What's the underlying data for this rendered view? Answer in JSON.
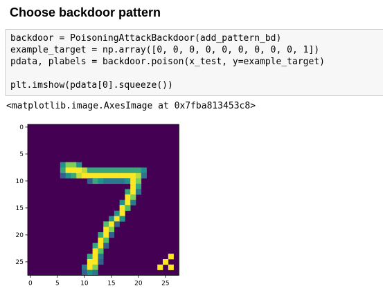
{
  "heading": "Choose backdoor pattern",
  "code": {
    "lines": [
      "backdoor = PoisoningAttackBackdoor(add_pattern_bd)",
      "example_target = np.array([0, 0, 0, 0, 0, 0, 0, 0, 0, 1])",
      "pdata, plabels = backdoor.poison(x_test, y=example_target)",
      "",
      "plt.imshow(pdata[0].squeeze())"
    ]
  },
  "output_text": "<matplotlib.image.AxesImage at 0x7fba813453c8>",
  "chart_data": {
    "type": "heatmap",
    "colormap": "viridis",
    "x_ticks": [
      "0",
      "5",
      "10",
      "15",
      "20",
      "25"
    ],
    "y_ticks": [
      "0",
      "5",
      "10",
      "15",
      "20",
      "25"
    ],
    "background_value": 0,
    "image_size": [
      28,
      28
    ],
    "pixels": [
      [
        7,
        6,
        0.5
      ],
      [
        7,
        7,
        0.8
      ],
      [
        7,
        8,
        0.8
      ],
      [
        7,
        9,
        0.5
      ],
      [
        8,
        6,
        0.6
      ],
      [
        8,
        7,
        1
      ],
      [
        8,
        8,
        1
      ],
      [
        8,
        9,
        1
      ],
      [
        8,
        10,
        0.9
      ],
      [
        8,
        11,
        0.6
      ],
      [
        8,
        12,
        0.6
      ],
      [
        8,
        13,
        0.6
      ],
      [
        8,
        14,
        0.6
      ],
      [
        8,
        15,
        0.6
      ],
      [
        8,
        16,
        0.6
      ],
      [
        8,
        17,
        0.6
      ],
      [
        8,
        18,
        0.6
      ],
      [
        8,
        19,
        0.6
      ],
      [
        8,
        20,
        0.6
      ],
      [
        8,
        21,
        0.5
      ],
      [
        9,
        6,
        0.3
      ],
      [
        9,
        7,
        0.5
      ],
      [
        9,
        8,
        0.6
      ],
      [
        9,
        9,
        0.9
      ],
      [
        9,
        10,
        1
      ],
      [
        9,
        11,
        1
      ],
      [
        9,
        12,
        1
      ],
      [
        9,
        13,
        1
      ],
      [
        9,
        14,
        1
      ],
      [
        9,
        15,
        1
      ],
      [
        9,
        16,
        1
      ],
      [
        9,
        17,
        1
      ],
      [
        9,
        18,
        1
      ],
      [
        9,
        19,
        1
      ],
      [
        9,
        20,
        0.9
      ],
      [
        9,
        21,
        0.4
      ],
      [
        10,
        11,
        0.3
      ],
      [
        10,
        12,
        0.6
      ],
      [
        10,
        13,
        0.5
      ],
      [
        10,
        14,
        0.4
      ],
      [
        10,
        15,
        0.4
      ],
      [
        10,
        16,
        0.4
      ],
      [
        10,
        17,
        0.4
      ],
      [
        10,
        18,
        0.5
      ],
      [
        10,
        19,
        1
      ],
      [
        10,
        20,
        0.8
      ],
      [
        11,
        19,
        1
      ],
      [
        11,
        20,
        0.6
      ],
      [
        12,
        18,
        0.6
      ],
      [
        12,
        19,
        1
      ],
      [
        12,
        20,
        0.4
      ],
      [
        13,
        18,
        1
      ],
      [
        13,
        19,
        0.8
      ],
      [
        14,
        17,
        0.5
      ],
      [
        14,
        18,
        1
      ],
      [
        14,
        19,
        0.4
      ],
      [
        15,
        17,
        1
      ],
      [
        15,
        18,
        0.7
      ],
      [
        16,
        16,
        0.5
      ],
      [
        16,
        17,
        1
      ],
      [
        17,
        15,
        0.5
      ],
      [
        17,
        16,
        1
      ],
      [
        17,
        17,
        0.5
      ],
      [
        18,
        14,
        0.7
      ],
      [
        18,
        15,
        1
      ],
      [
        18,
        16,
        0.3
      ],
      [
        19,
        14,
        1
      ],
      [
        19,
        15,
        0.8
      ],
      [
        20,
        13,
        0.6
      ],
      [
        20,
        14,
        1
      ],
      [
        20,
        15,
        0.3
      ],
      [
        21,
        13,
        1
      ],
      [
        21,
        14,
        0.7
      ],
      [
        22,
        12,
        0.6
      ],
      [
        22,
        13,
        1
      ],
      [
        22,
        14,
        0.3
      ],
      [
        23,
        12,
        1
      ],
      [
        23,
        13,
        0.7
      ],
      [
        24,
        11,
        0.6
      ],
      [
        24,
        12,
        1
      ],
      [
        24,
        13,
        0.4
      ],
      [
        25,
        11,
        1
      ],
      [
        25,
        12,
        1
      ],
      [
        25,
        13,
        0.3
      ],
      [
        26,
        10,
        0.4
      ],
      [
        26,
        11,
        1
      ],
      [
        26,
        12,
        0.8
      ],
      [
        27,
        10,
        0.3
      ],
      [
        27,
        11,
        0.5
      ],
      [
        27,
        12,
        0.4
      ],
      [
        24,
        26,
        1
      ],
      [
        25,
        25,
        1
      ],
      [
        26,
        24,
        1
      ],
      [
        26,
        26,
        1
      ]
    ]
  }
}
